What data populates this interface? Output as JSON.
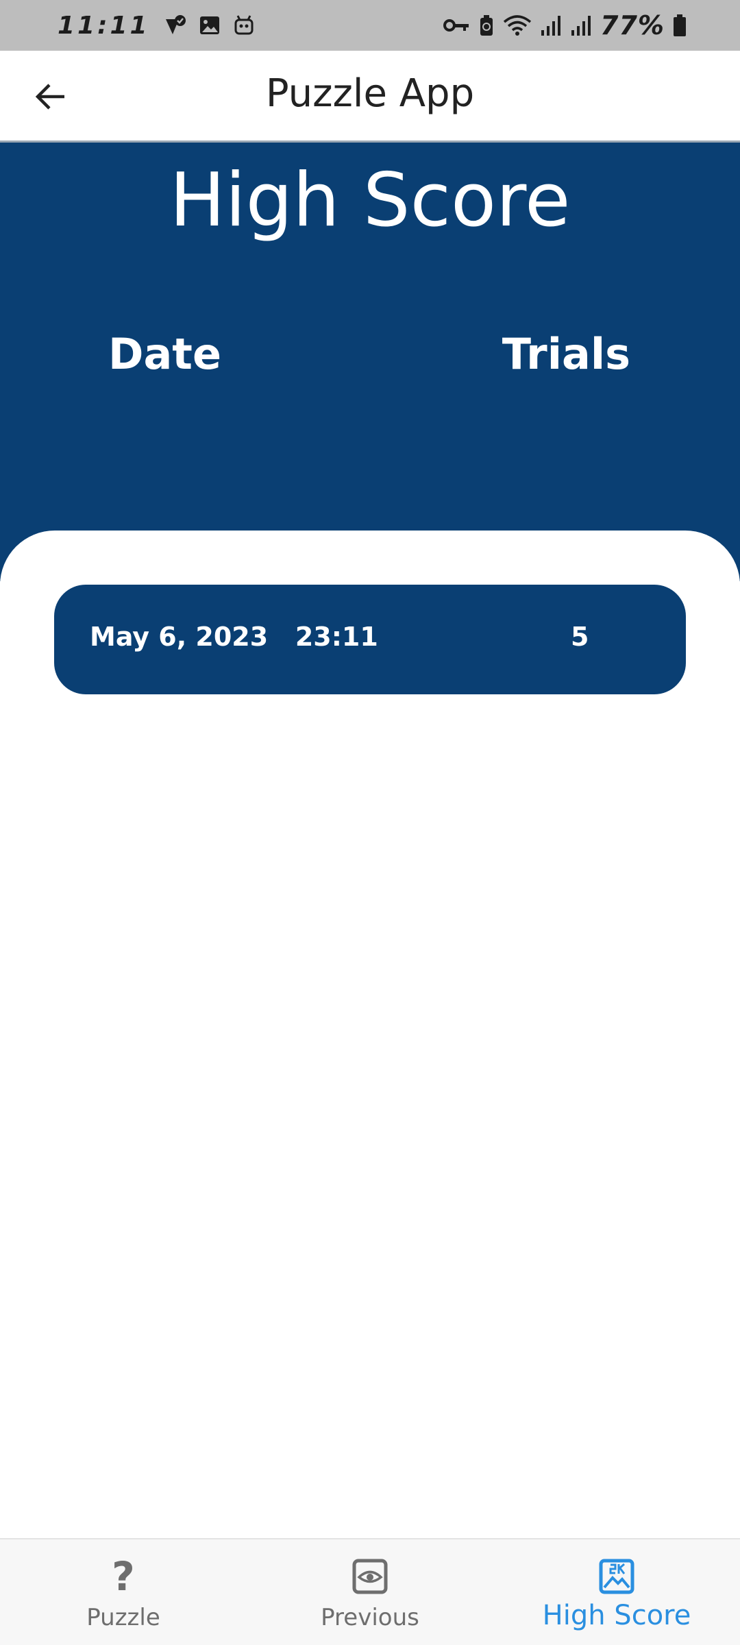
{
  "status_bar": {
    "time": "11:11",
    "battery_percent": "77%",
    "left_icons": [
      "notification-check-icon",
      "image-icon",
      "robot-icon"
    ],
    "right_icons": [
      "vpn-key-icon",
      "battery-saver-icon",
      "wifi-icon",
      "signal-icon",
      "signal-icon",
      "battery-icon"
    ]
  },
  "app_bar": {
    "title": "Puzzle App",
    "back_icon": "arrow-left-icon"
  },
  "header": {
    "title": "High Score",
    "columns": {
      "date": "Date",
      "trials": "Trials"
    }
  },
  "scores": [
    {
      "date": "May 6, 2023   23:11",
      "trials": "5"
    }
  ],
  "bottom_nav": {
    "items": [
      {
        "label": "Puzzle",
        "icon": "question-mark-icon",
        "active": false
      },
      {
        "label": "Previous",
        "icon": "eye-icon",
        "active": false
      },
      {
        "label": "High Score",
        "icon": "leaderboard-image-icon",
        "active": true
      }
    ]
  },
  "colors": {
    "primary": "#0a3f73",
    "active_nav": "#2a8fe0",
    "inactive_nav": "#6e6e6e",
    "status_bar_bg": "#bdbdbd"
  }
}
